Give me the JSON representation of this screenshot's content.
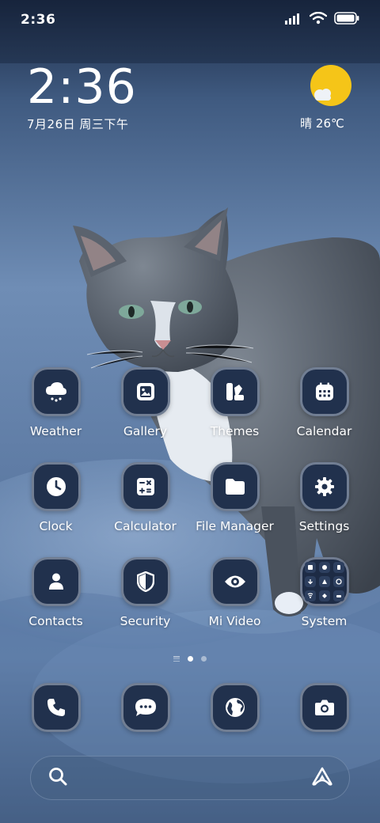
{
  "status_bar": {
    "time": "2:36",
    "icons": [
      "signal-icon",
      "wifi-icon",
      "battery-icon"
    ]
  },
  "clock_widget": {
    "time": "2:36",
    "date": "7月26日 周三下午"
  },
  "weather_widget": {
    "condition_icon": "sun-with-cloud-icon",
    "text": "晴 26℃"
  },
  "apps": [
    {
      "label": "Weather",
      "icon": "weather-cloud-icon"
    },
    {
      "label": "Gallery",
      "icon": "gallery-icon"
    },
    {
      "label": "Themes",
      "icon": "themes-icon"
    },
    {
      "label": "Calendar",
      "icon": "calendar-icon"
    },
    {
      "label": "Clock",
      "icon": "clock-icon"
    },
    {
      "label": "Calculator",
      "icon": "calculator-icon"
    },
    {
      "label": "File Manager",
      "icon": "folder-icon"
    },
    {
      "label": "Settings",
      "icon": "gear-icon"
    },
    {
      "label": "Contacts",
      "icon": "contact-icon"
    },
    {
      "label": "Security",
      "icon": "shield-icon"
    },
    {
      "label": "Mi Video",
      "icon": "eye-icon"
    },
    {
      "label": "System",
      "icon": "folder-grid-icon"
    }
  ],
  "page_indicator": {
    "pages": 2,
    "active_page": 1
  },
  "dock": [
    {
      "icon": "phone-icon"
    },
    {
      "icon": "message-icon"
    },
    {
      "icon": "browser-globe-icon"
    },
    {
      "icon": "camera-icon"
    }
  ],
  "search_bar": {
    "placeholder": "",
    "left_icon": "search-icon",
    "right_icon": "assistant-icon"
  },
  "colors": {
    "icon_background": "#21314d",
    "wallpaper_blue": "#4f6e96",
    "sun": "#f5c518"
  }
}
